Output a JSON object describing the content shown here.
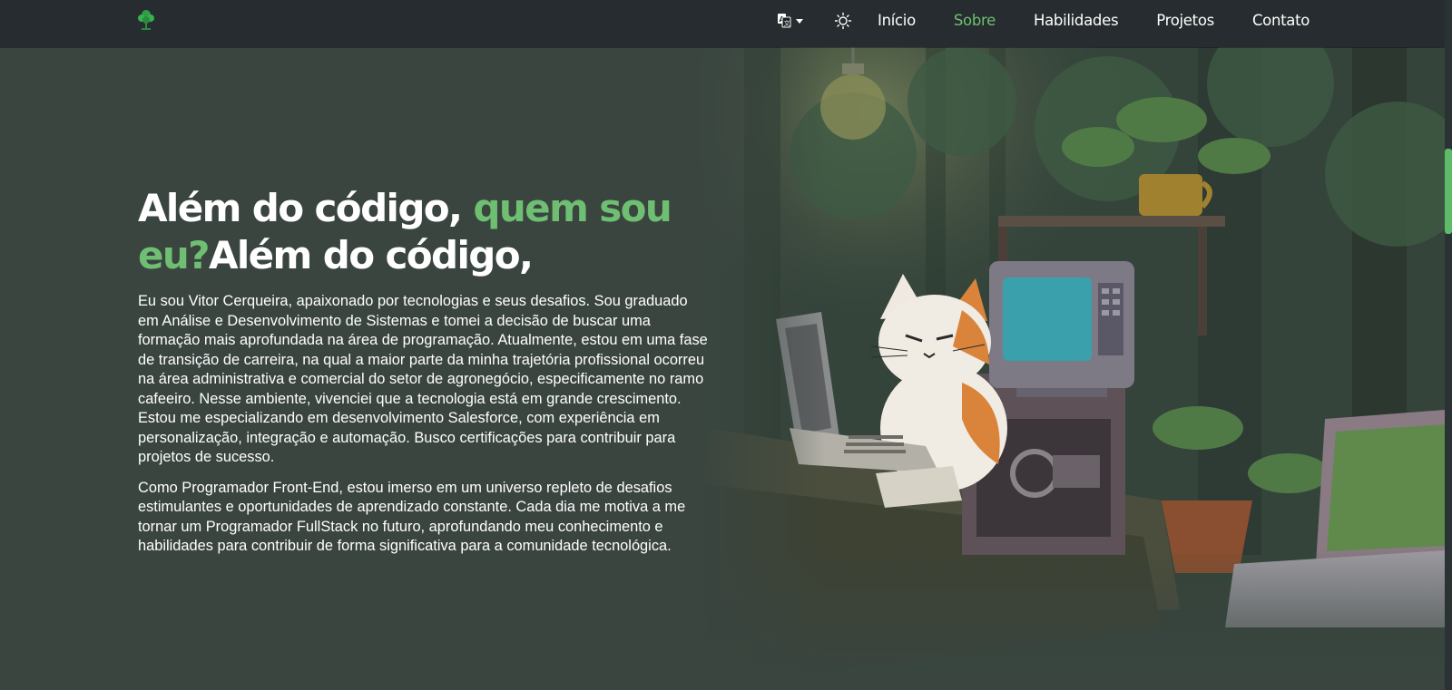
{
  "nav": {
    "logo_icon": "tree-logo-icon",
    "language_icon": "translate-icon",
    "theme_icon": "sun-icon",
    "links": [
      {
        "label": "Início",
        "active": false
      },
      {
        "label": "Sobre",
        "active": true
      },
      {
        "label": "Habilidades",
        "active": false
      },
      {
        "label": "Projetos",
        "active": false
      },
      {
        "label": "Contato",
        "active": false
      }
    ]
  },
  "about": {
    "title_part1": "Além do código, ",
    "title_accent": "quem sou eu?",
    "title_part2": "Além do código,",
    "paragraph1": "Eu sou Vitor Cerqueira, apaixonado por tecnologias e seus desafios. Sou graduado em Análise e Desenvolvimento de Sistemas e tomei a decisão de buscar uma formação mais aprofundada na área de programação. Atualmente, estou em uma fase de transição de carreira, na qual a maior parte da minha trajetória profissional ocorreu na área administrativa e comercial do setor de agronegócio, especificamente no ramo cafeeiro. Nesse ambiente, vivenciei que a tecnologia está em grande crescimento. Estou me especializando em desenvolvimento Salesforce, com experiência em personalização, integração e automação. Busco certificações para contribuir para projetos de sucesso.",
    "paragraph2": "Como Programador Front-End, estou imerso em um universo repleto de desafios estimulantes e oportunidades de aprendizado constante. Cada dia me motiva a me tornar um Programador FullStack no futuro, aprofundando meu conhecimento e habilidades para contribuir de forma significativa para a comunidade tecnológica."
  },
  "colors": {
    "background": "#3a4540",
    "navbar": "#262c2f",
    "accent": "#6fbf73",
    "text": "#ffffff"
  },
  "hero_image_icon": "cat-programmer-forest-illustration"
}
